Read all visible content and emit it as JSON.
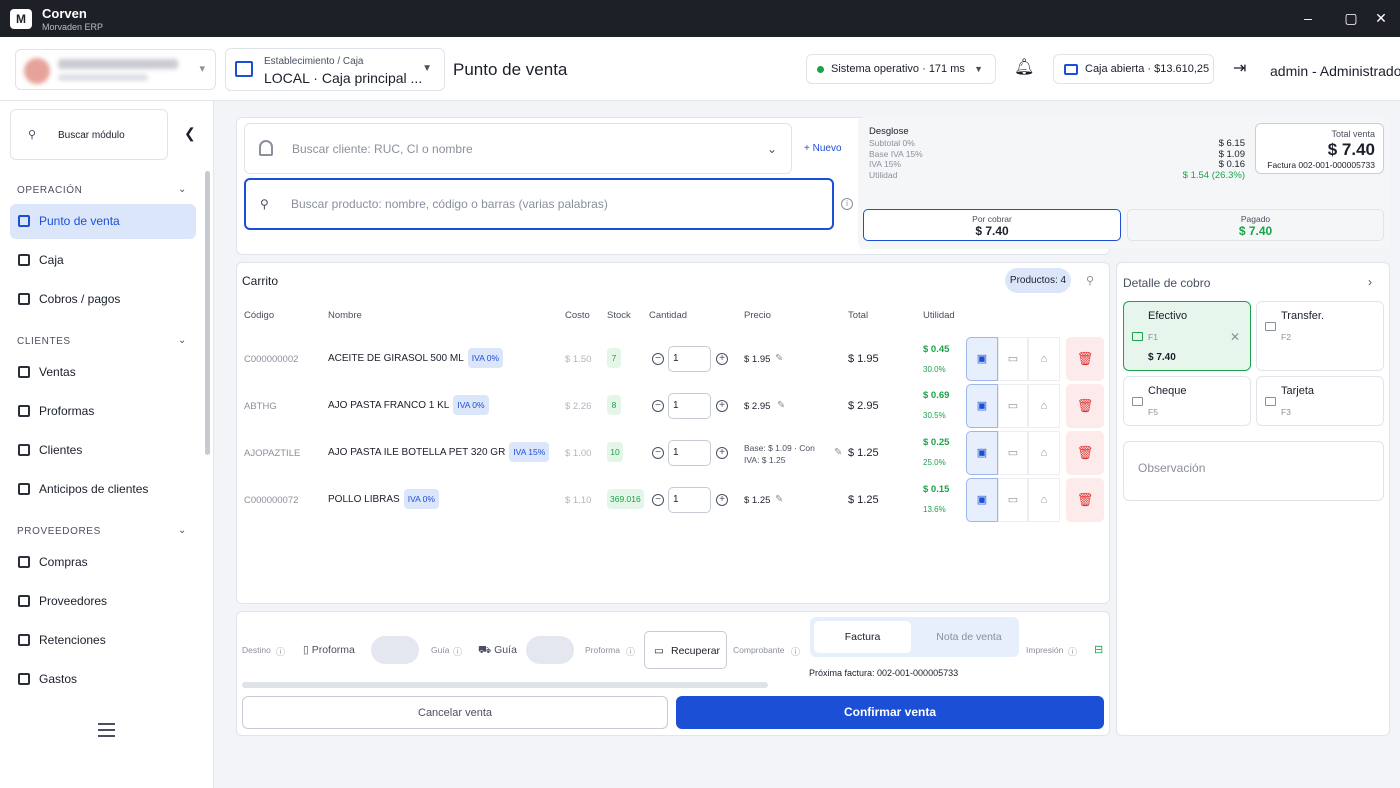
{
  "titlebar": {
    "app_name": "Corven",
    "app_sub": "Morvaden ERP",
    "logo": "M"
  },
  "header": {
    "estab_label": "Establecimiento / Caja",
    "estab_value": "LOCAL · Caja principal ...",
    "page_title": "Punto de venta",
    "system_status": "Sistema operativo · 171 ms",
    "caja_status": "Caja abierta · $13.610,25",
    "user": "admin - Administrador"
  },
  "sidebar": {
    "search_label": "Buscar módulo",
    "sections": [
      {
        "title": "OPERACIÓN",
        "items": [
          "Punto de venta",
          "Caja",
          "Cobros / pagos"
        ]
      },
      {
        "title": "CLIENTES",
        "items": [
          "Ventas",
          "Proformas",
          "Clientes",
          "Anticipos de clientes"
        ]
      },
      {
        "title": "PROVEEDORES",
        "items": [
          "Compras",
          "Proveedores",
          "Retenciones",
          "Gastos"
        ]
      }
    ]
  },
  "search": {
    "customer_placeholder": "Buscar cliente: RUC, CI o nombre",
    "new_label": "Nuevo",
    "product_placeholder": "Buscar producto: nombre, código o barras (varias palabras)"
  },
  "breakdown": {
    "title": "Desglose",
    "rows": [
      {
        "label": "Subtotal 0%",
        "value": "$ 6.15"
      },
      {
        "label": "Base IVA 15%",
        "value": "$ 1.09"
      },
      {
        "label": "IVA 15%",
        "value": "$ 0.16"
      },
      {
        "label": "Utilidad",
        "value": "$ 1.54",
        "extra": "(26.3%)"
      }
    ]
  },
  "total": {
    "label": "Total venta",
    "value": "$ 7.40",
    "invoice": "Factura 002-001-000005733"
  },
  "por_cobrar": {
    "label": "Por cobrar",
    "value": "$ 7.40"
  },
  "pagado": {
    "label": "Pagado",
    "value": "$ 7.40"
  },
  "cart": {
    "title": "Carrito",
    "count_label": "Productos: 4",
    "columns": [
      "Código",
      "Nombre",
      "Costo",
      "Stock",
      "Cantidad",
      "Precio",
      "Total",
      "Utilidad"
    ],
    "rows": [
      {
        "code": "C000000002",
        "name": "ACEITE DE GIRASOL 500 ML",
        "iva": "IVA 0%",
        "cost": "$ 1.50",
        "stock": "7",
        "qty": "1",
        "price": "$ 1.95",
        "total": "$ 1.95",
        "util": "$ 0.45",
        "util_pct": "30.0%"
      },
      {
        "code": "ABTHG",
        "name": "AJO PASTA FRANCO 1 KL",
        "iva": "IVA 0%",
        "cost": "$ 2.26",
        "stock": "8",
        "qty": "1",
        "price": "$ 2.95",
        "total": "$ 2.95",
        "util": "$ 0.69",
        "util_pct": "30.5%"
      },
      {
        "code": "AJOPAZTILE",
        "name": "AJO PASTA ILE BOTELLA PET 320 GR",
        "iva": "IVA 15%",
        "cost": "$ 1.00",
        "stock": "10",
        "qty": "1",
        "price_line1": "Base: $ 1.09 · Con",
        "price_line2": "IVA: $ 1.25",
        "total": "$ 1.25",
        "util": "$ 0.25",
        "util_pct": "25.0%"
      },
      {
        "code": "C000000072",
        "name": "POLLO LIBRAS",
        "iva": "IVA 0%",
        "cost": "$ 1.10",
        "stock": "369.016",
        "qty": "1",
        "price": "$ 1.25",
        "total": "$ 1.25",
        "util": "$ 0.15",
        "util_pct": "13.6%"
      }
    ]
  },
  "footer": {
    "destino": "Destino",
    "proforma_toggle": "Proforma",
    "guia_small": "Guía",
    "guia_toggle": "Guía",
    "proforma_small": "Proforma",
    "recuperar": "Recuperar",
    "comprobante": "Comprobante",
    "seg_factura": "Factura",
    "seg_nota": "Nota de venta",
    "impresion": "Impresión",
    "next_invoice": "Próxima factura: 002-001-000005733",
    "cancel": "Cancelar venta",
    "confirm": "Confirmar venta"
  },
  "payment": {
    "title": "Detalle de cobro",
    "methods": [
      {
        "label": "Efectivo",
        "key": "F1",
        "amount": "$ 7.40"
      },
      {
        "label": "Transfer.",
        "key": "F2"
      },
      {
        "label": "Cheque",
        "key": "F5"
      },
      {
        "label": "Tarjeta",
        "key": "F3"
      }
    ],
    "observation": "Observación"
  }
}
